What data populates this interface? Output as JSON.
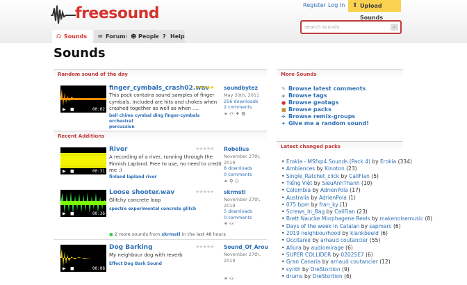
{
  "header": {
    "logo": "freesound",
    "register": "Register",
    "login": "Log In",
    "upload": "Upload Sounds",
    "search_placeholder": "search sounds"
  },
  "tabs": [
    {
      "label": "Sounds",
      "icon": "headphones-icon"
    },
    {
      "label": "Forums",
      "icon": "forum-icon"
    },
    {
      "label": "People",
      "icon": "people-icon"
    },
    {
      "label": "Help",
      "icon": "help-icon"
    }
  ],
  "page_title": "Sounds",
  "random": {
    "heading": "Random sound of the day",
    "title": "finger_cymbals_crash02.wav",
    "desc1": "This pack contains sound samples of finger",
    "desc2": "cymbals. Included are hits and chokes when",
    "desc3": "crashed together as well as when ....",
    "tags1": "bell chime cymbal ding finger-cymbals orchestral",
    "tags2": "percussion",
    "user": "soundbytez",
    "date": "May 30th, 2011",
    "downloads": "256 downloads",
    "comments": "2 comments",
    "time": "00:02"
  },
  "recent": {
    "heading": "Recent Additions",
    "items": [
      {
        "title": "River",
        "desc1": "A recording of a river, running through the",
        "desc2": "Finnish Lapland. Free to use, no need to credit",
        "desc3": "me :)",
        "tags": "finland lapland river",
        "user": "Robelius",
        "date1": "November 27th,",
        "date2": "2019",
        "downloads": "8 downloads",
        "comments": "0 comments",
        "time": "00:31"
      },
      {
        "title": "Loose shooter.wav",
        "desc1": "Glitchy concrete loop",
        "desc2": "",
        "desc3": "",
        "tags": "spectre experimental concrete glitch",
        "user": "skrmstl",
        "date1": "November 27th,",
        "date2": "2019",
        "downloads": "5 downloads",
        "comments": "0 comments",
        "time": "00:36"
      },
      {
        "title": "Dog Barking",
        "desc1": "My neighbour dog with reverb",
        "desc2": "",
        "desc3": "",
        "tags": "Effect Dog Bark Sound",
        "user": "Sound_Of_Arou",
        "date1": "November 27th,",
        "date2": "2019",
        "downloads": "",
        "comments": "",
        "time": "00:08"
      }
    ],
    "more_prefix": "2 more sounds from",
    "more_user": "skrmstl",
    "more_suffix": "in the last 48 hours"
  },
  "more_sounds": {
    "heading": "More Sounds",
    "items": [
      {
        "label": "Browse latest comments",
        "icon": "comment-icon"
      },
      {
        "label": "Browse tags",
        "icon": "tag-icon"
      },
      {
        "label": "Browse geotags",
        "icon": "geotag-icon"
      },
      {
        "label": "Browse packs",
        "icon": "pack-icon"
      },
      {
        "label": "Browse remix-groups",
        "icon": "remix-icon"
      },
      {
        "label": "Give me a random sound!",
        "icon": "random-icon"
      }
    ]
  },
  "packs": {
    "heading": "Latest changed packs",
    "items": [
      {
        "name": "Erokia - MSfxp4 Sounds (Pack 4)",
        "by": "Erokia",
        "count": "(334)"
      },
      {
        "name": "Ambiences",
        "by": "Kinoton",
        "count": "(23)"
      },
      {
        "name": "Single_Ratchet_click",
        "by": "CallFlan",
        "count": "(5)"
      },
      {
        "name": "Tiếng Việt",
        "by": "SieuAnhThanh",
        "count": "(10)"
      },
      {
        "name": "Colombia",
        "by": "AdrienPola",
        "count": "(17)"
      },
      {
        "name": "Australia",
        "by": "AdrienPola",
        "count": "(1)"
      },
      {
        "name": "075 bpm",
        "by": "fran_ky",
        "count": "(1)"
      },
      {
        "name": "Screws_In_Bag",
        "by": "CallFlan",
        "count": "(23)"
      },
      {
        "name": "Brett Naucke Morphagene Reels",
        "by": "makenoisemusic",
        "count": "(8)"
      },
      {
        "name": "Days of the week in Catalan",
        "by": "sapmarc",
        "count": "(6)"
      },
      {
        "name": "2019 neighbourhood",
        "by": "klankbeeld",
        "count": "(6)"
      },
      {
        "name": "Occitanie",
        "by": "arnaud coutancier",
        "count": "(55)"
      },
      {
        "name": "Allura",
        "by": "audiomirage",
        "count": "(6)"
      },
      {
        "name": "SUPER COLLIDER",
        "by": "0202SE7",
        "count": "(6)"
      },
      {
        "name": "Gran Canaria",
        "by": "arnaud coutancier",
        "count": "(12)"
      },
      {
        "name": "synth",
        "by": "DreStortion",
        "count": "(9)"
      },
      {
        "name": "drums",
        "by": "DreStortion",
        "count": "(6)"
      }
    ]
  },
  "by_word": "by",
  "colors": {
    "brand": "#d6332f",
    "link": "#2e6fb5",
    "upload": "#fbd24f"
  }
}
